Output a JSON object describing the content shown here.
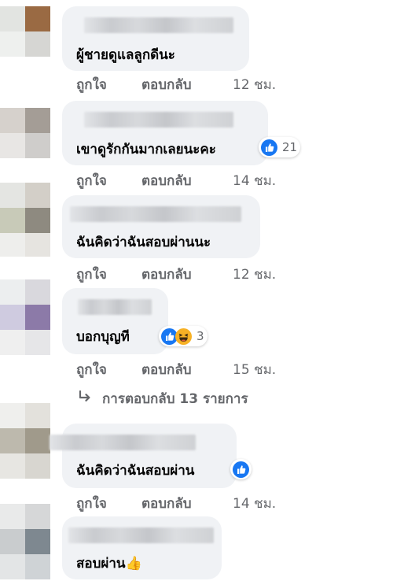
{
  "actions": {
    "like": "ถูกใจ",
    "reply": "ตอบกลับ"
  },
  "comments": [
    {
      "text": "ผู้ชายดูแลลูกดีนะ",
      "time": "12 ชม."
    },
    {
      "text": "เขาดูรักกันมากเลยนะคะ",
      "time": "14 ชม.",
      "reaction_count": "21",
      "reactions": [
        "like-icon"
      ]
    },
    {
      "text": "ฉันคิดว่าฉันสอบผ่านนะ",
      "time": "12 ชม."
    },
    {
      "text": "บอกบุญที",
      "time": "15 ชม.",
      "reaction_count": "3",
      "reactions": [
        "like-icon",
        "haha-icon"
      ]
    },
    {
      "text": "ฉันคิดว่าฉันสอบผ่าน",
      "time": "14 ชม.",
      "reactions": [
        "like-icon"
      ]
    },
    {
      "text": "สอบผ่าน👍"
    }
  ],
  "replies_link": {
    "label": "การตอบกลับ 13 รายการ",
    "icon": "reply-arrow-icon"
  },
  "colors": {
    "bubble": "#f0f2f5",
    "meta_text": "#65676b",
    "like_blue": "#1877f2",
    "haha_yellow": "#f7b125"
  }
}
